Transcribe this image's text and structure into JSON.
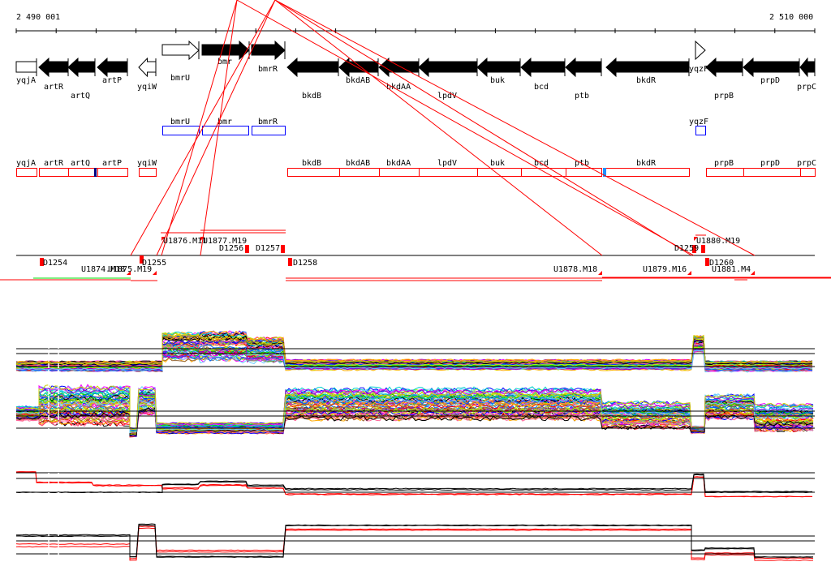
{
  "ruler": {
    "start_label": "2 490 001",
    "end_label": "2 510 000"
  },
  "genes": [
    {
      "name": "yqjA",
      "strand": "none"
    },
    {
      "name": "artR",
      "strand": "-"
    },
    {
      "name": "artQ",
      "strand": "-"
    },
    {
      "name": "artP",
      "strand": "-"
    },
    {
      "name": "yqiW",
      "strand": "-"
    },
    {
      "name": "bmrU",
      "strand": "+"
    },
    {
      "name": "bmr",
      "strand": "+"
    },
    {
      "name": "bmrR",
      "strand": "+"
    },
    {
      "name": "bkdB",
      "strand": "-"
    },
    {
      "name": "bkdAB",
      "strand": "-"
    },
    {
      "name": "bkdAA",
      "strand": "-"
    },
    {
      "name": "lpdV",
      "strand": "-"
    },
    {
      "name": "buk",
      "strand": "-"
    },
    {
      "name": "bcd",
      "strand": "-"
    },
    {
      "name": "ptb",
      "strand": "-"
    },
    {
      "name": "bkdR",
      "strand": "-"
    },
    {
      "name": "yqzF",
      "strand": "+"
    },
    {
      "name": "prpB",
      "strand": "-"
    },
    {
      "name": "prpD",
      "strand": "-"
    },
    {
      "name": "prpC",
      "strand": "-"
    }
  ],
  "plus_strand_boxes": [
    "bmrU",
    "bmr",
    "bmrR",
    "yqzF"
  ],
  "minus_strand_boxes": [
    "yqjA",
    "artR",
    "artQ",
    "artP",
    "yqiW",
    "bkdB",
    "bkdAB",
    "bkdAA",
    "lpdV",
    "buk",
    "bcd",
    "ptb",
    "bkdR",
    "prpB",
    "prpD",
    "prpC"
  ],
  "transcription_units": {
    "upstream": [
      "U1876.M11",
      "U1877.M19",
      "U1880.M19"
    ],
    "downstream": [
      "U1874.M18",
      "U1875.M19",
      "U1878.M18",
      "U1879.M16",
      "U1881.M4"
    ],
    "terminators": [
      "D1254",
      "D1255",
      "D1256",
      "D1257",
      "D1258",
      "D1259",
      "D1260"
    ]
  },
  "colors": {
    "gene_fill": "#000000",
    "plus_box": "#0000ff",
    "minus_box": "#ff0000",
    "marker": "#ff0000"
  }
}
